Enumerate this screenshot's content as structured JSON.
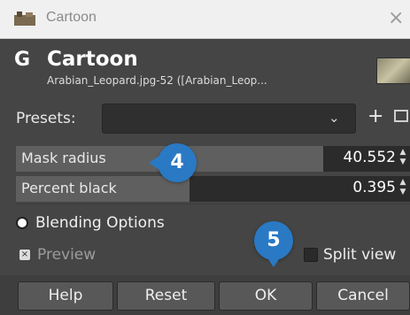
{
  "window": {
    "title": "Cartoon",
    "close_symbol": "×"
  },
  "header": {
    "logo_symbol": "G",
    "title": "Cartoon",
    "subtitle": "Arabian_Leopard.jpg-52 ([Arabian_Leop..."
  },
  "presets": {
    "label": "Presets:",
    "value": "",
    "add_symbol": "+"
  },
  "params": [
    {
      "label": "Mask radius",
      "value": "40.552",
      "fill_fraction": 0.78
    },
    {
      "label": "Percent black",
      "value": "0.395",
      "fill_fraction": 0.44
    }
  ],
  "blending": {
    "label": "Blending Options"
  },
  "preview": {
    "label": "Preview",
    "checked": true,
    "check_symbol": "×"
  },
  "split_view": {
    "label": "Split view",
    "checked": false
  },
  "buttons": {
    "help": "Help",
    "reset": "Reset",
    "ok": "OK",
    "cancel": "Cancel"
  },
  "badges": {
    "b4": "4",
    "b5": "5"
  },
  "colors": {
    "badge": "#2a79c4",
    "dialog_bg": "#454545",
    "titlebar_bg": "#f0f0f0"
  }
}
